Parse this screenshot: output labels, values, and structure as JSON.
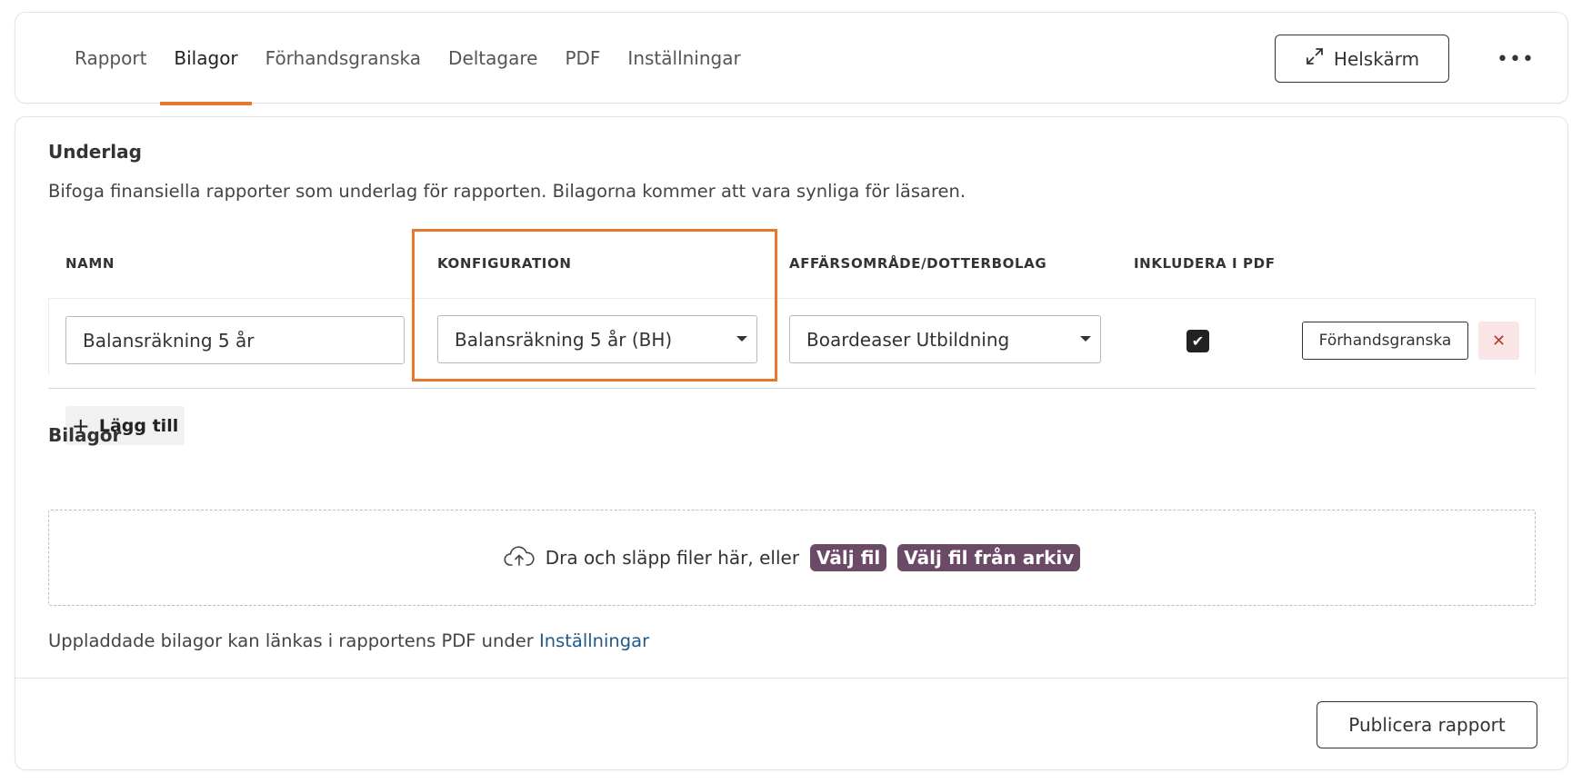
{
  "tabs": [
    {
      "label": "Rapport"
    },
    {
      "label": "Bilagor"
    },
    {
      "label": "Förhandsgranska"
    },
    {
      "label": "Deltagare"
    },
    {
      "label": "PDF"
    },
    {
      "label": "Inställningar"
    }
  ],
  "active_tab": "Bilagor",
  "header": {
    "fullscreen_label": "Helskärm",
    "more_label": "•••"
  },
  "underlag": {
    "title": "Underlag",
    "description": "Bifoga finansiella rapporter som underlag för rapporten. Bilagorna kommer att vara synliga för läsaren.",
    "columns": {
      "name": "NAMN",
      "config": "KONFIGURATION",
      "area": "AFFÄRSOMRÅDE/DOTTERBOLAG",
      "include_pdf": "INKLUDERA I PDF"
    },
    "row": {
      "name_value": "Balansräkning 5 år",
      "config_value": "Balansräkning 5 år (BH)",
      "area_value": "Boardeaser Utbildning",
      "include_pdf": true,
      "preview_label": "Förhandsgranska",
      "delete_symbol": "✕"
    },
    "add_label": "Lägg till",
    "add_symbol": "+"
  },
  "bilagor": {
    "title": "Bilagor",
    "dropzone_text": "Dra och släpp filer här, eller",
    "choose_file_label": "Välj fil",
    "choose_archive_label": "Välj fil från arkiv",
    "footnote_text": "Uppladdade bilagor kan länkas i rapportens PDF under",
    "footnote_link": "Inställningar"
  },
  "footer": {
    "publish_label": "Publicera rapport"
  },
  "colors": {
    "accent": "#e8772e",
    "pill": "#6b4a66",
    "link": "#1f5a8a",
    "delete_bg": "#f9e4e6"
  }
}
